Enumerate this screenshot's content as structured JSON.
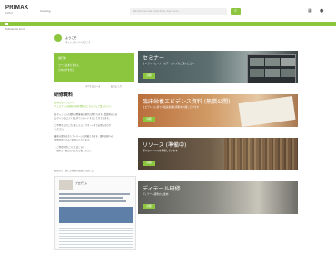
{
  "header": {
    "logo": "PRIMAK",
    "logo_sub": "Institut",
    "nav_item": "Catalog",
    "search_placeholder": "Recherchez des collections, des cours…",
    "search_button": "⌕",
    "grid_icon": "grid-icon",
    "user_icon": "user-icon",
    "accent": "#8cc63f"
  },
  "breadcrumb": "Tableau de bord",
  "profile": {
    "name": "ようこそ",
    "sub": "ダッシュボードへようこそ"
  },
  "green_card": {
    "line1": "進行中",
    "line2": "コースはありません",
    "line3": "カタログを見る",
    "link1": "すべてのコース",
    "link2": "お気に入り"
  },
  "section": {
    "title": "研修資料",
    "intro1": "資料のダウンロード",
    "intro2": "ウェビナーの録画と研修資料はこちらからご覧ください",
    "lines": [
      "各セッションの資料は開催後に順次公開されます。受講者の方は",
      "ログイン後にいつでもダウンロードすることができます。",
      "ご不明な点がございましたら、サポートまでお問い合わせ",
      "ください。",
      "最新の資料はセミナーページに掲載されます。資料は個人の",
      "学習目的でのみご利用いただけます。",
      "・ご利用条件についてはこちら",
      "・資料の一覧はこちらをご覧ください"
    ],
    "footer_note": "お知らせ：新しい資料が追加されました"
  },
  "thumbnail": {
    "title": "プログラム"
  },
  "banners": [
    {
      "title": "セミナー",
      "sub": "オンラインセミナーのアーカイブをご覧ください",
      "button": "詳細"
    },
    {
      "title": "臨床栄養エビデンス資料 (無償公開)",
      "sub": "エビデンスに基づく臨床栄養の資料を公開しています",
      "button": "詳細"
    },
    {
      "title": "リソース (準備中)",
      "sub": "様々なリソースを準備しています",
      "button": "詳細"
    },
    {
      "title": "ディテール研修",
      "sub": "ディテール研修のご案内",
      "button": "詳細"
    }
  ]
}
